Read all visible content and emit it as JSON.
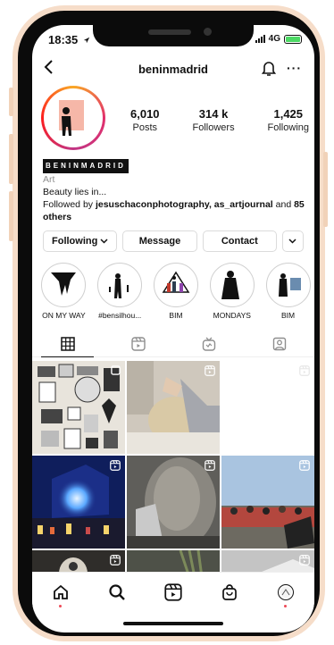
{
  "status_bar": {
    "time": "18:35",
    "network": "4G"
  },
  "header": {
    "username": "beninmadrid"
  },
  "profile": {
    "stats": [
      {
        "num": "6,010",
        "label": "Posts"
      },
      {
        "num": "314 k",
        "label": "Followers"
      },
      {
        "num": "1,425",
        "label": "Following"
      }
    ],
    "name": "BENINMADRID",
    "category": "Art",
    "bio": "Beauty lies in...",
    "followed_by_prefix": "Followed by ",
    "followed_by_names": "jesuschaconphotography, as_artjournal",
    "followed_by_and": " and ",
    "followed_by_others": "85 others"
  },
  "actions": {
    "following": "Following",
    "message": "Message",
    "contact": "Contact"
  },
  "highlights": [
    {
      "label": "ON MY WAY"
    },
    {
      "label": "#bensilhou..."
    },
    {
      "label": "BIM"
    },
    {
      "label": "MONDAYS"
    },
    {
      "label": "BIM"
    }
  ],
  "colors": {
    "accent_red": "#ed4956",
    "border": "#dbdbdb",
    "muted": "#8e8e8e"
  }
}
